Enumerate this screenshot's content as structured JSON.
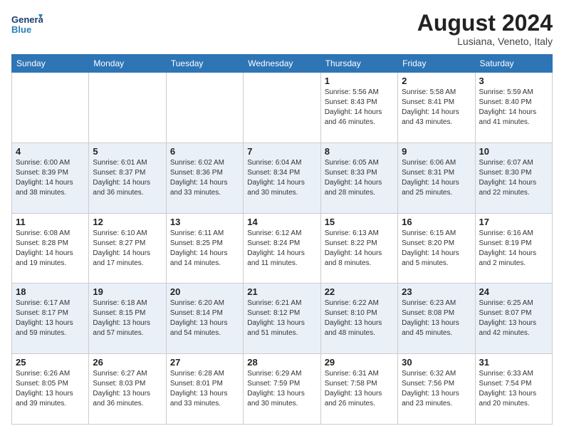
{
  "logo": {
    "line1": "General",
    "line2": "Blue"
  },
  "title": "August 2024",
  "location": "Lusiana, Veneto, Italy",
  "weekdays": [
    "Sunday",
    "Monday",
    "Tuesday",
    "Wednesday",
    "Thursday",
    "Friday",
    "Saturday"
  ],
  "weeks": [
    [
      {
        "day": "",
        "info": ""
      },
      {
        "day": "",
        "info": ""
      },
      {
        "day": "",
        "info": ""
      },
      {
        "day": "",
        "info": ""
      },
      {
        "day": "1",
        "info": "Sunrise: 5:56 AM\nSunset: 8:43 PM\nDaylight: 14 hours\nand 46 minutes."
      },
      {
        "day": "2",
        "info": "Sunrise: 5:58 AM\nSunset: 8:41 PM\nDaylight: 14 hours\nand 43 minutes."
      },
      {
        "day": "3",
        "info": "Sunrise: 5:59 AM\nSunset: 8:40 PM\nDaylight: 14 hours\nand 41 minutes."
      }
    ],
    [
      {
        "day": "4",
        "info": "Sunrise: 6:00 AM\nSunset: 8:39 PM\nDaylight: 14 hours\nand 38 minutes."
      },
      {
        "day": "5",
        "info": "Sunrise: 6:01 AM\nSunset: 8:37 PM\nDaylight: 14 hours\nand 36 minutes."
      },
      {
        "day": "6",
        "info": "Sunrise: 6:02 AM\nSunset: 8:36 PM\nDaylight: 14 hours\nand 33 minutes."
      },
      {
        "day": "7",
        "info": "Sunrise: 6:04 AM\nSunset: 8:34 PM\nDaylight: 14 hours\nand 30 minutes."
      },
      {
        "day": "8",
        "info": "Sunrise: 6:05 AM\nSunset: 8:33 PM\nDaylight: 14 hours\nand 28 minutes."
      },
      {
        "day": "9",
        "info": "Sunrise: 6:06 AM\nSunset: 8:31 PM\nDaylight: 14 hours\nand 25 minutes."
      },
      {
        "day": "10",
        "info": "Sunrise: 6:07 AM\nSunset: 8:30 PM\nDaylight: 14 hours\nand 22 minutes."
      }
    ],
    [
      {
        "day": "11",
        "info": "Sunrise: 6:08 AM\nSunset: 8:28 PM\nDaylight: 14 hours\nand 19 minutes."
      },
      {
        "day": "12",
        "info": "Sunrise: 6:10 AM\nSunset: 8:27 PM\nDaylight: 14 hours\nand 17 minutes."
      },
      {
        "day": "13",
        "info": "Sunrise: 6:11 AM\nSunset: 8:25 PM\nDaylight: 14 hours\nand 14 minutes."
      },
      {
        "day": "14",
        "info": "Sunrise: 6:12 AM\nSunset: 8:24 PM\nDaylight: 14 hours\nand 11 minutes."
      },
      {
        "day": "15",
        "info": "Sunrise: 6:13 AM\nSunset: 8:22 PM\nDaylight: 14 hours\nand 8 minutes."
      },
      {
        "day": "16",
        "info": "Sunrise: 6:15 AM\nSunset: 8:20 PM\nDaylight: 14 hours\nand 5 minutes."
      },
      {
        "day": "17",
        "info": "Sunrise: 6:16 AM\nSunset: 8:19 PM\nDaylight: 14 hours\nand 2 minutes."
      }
    ],
    [
      {
        "day": "18",
        "info": "Sunrise: 6:17 AM\nSunset: 8:17 PM\nDaylight: 13 hours\nand 59 minutes."
      },
      {
        "day": "19",
        "info": "Sunrise: 6:18 AM\nSunset: 8:15 PM\nDaylight: 13 hours\nand 57 minutes."
      },
      {
        "day": "20",
        "info": "Sunrise: 6:20 AM\nSunset: 8:14 PM\nDaylight: 13 hours\nand 54 minutes."
      },
      {
        "day": "21",
        "info": "Sunrise: 6:21 AM\nSunset: 8:12 PM\nDaylight: 13 hours\nand 51 minutes."
      },
      {
        "day": "22",
        "info": "Sunrise: 6:22 AM\nSunset: 8:10 PM\nDaylight: 13 hours\nand 48 minutes."
      },
      {
        "day": "23",
        "info": "Sunrise: 6:23 AM\nSunset: 8:08 PM\nDaylight: 13 hours\nand 45 minutes."
      },
      {
        "day": "24",
        "info": "Sunrise: 6:25 AM\nSunset: 8:07 PM\nDaylight: 13 hours\nand 42 minutes."
      }
    ],
    [
      {
        "day": "25",
        "info": "Sunrise: 6:26 AM\nSunset: 8:05 PM\nDaylight: 13 hours\nand 39 minutes."
      },
      {
        "day": "26",
        "info": "Sunrise: 6:27 AM\nSunset: 8:03 PM\nDaylight: 13 hours\nand 36 minutes."
      },
      {
        "day": "27",
        "info": "Sunrise: 6:28 AM\nSunset: 8:01 PM\nDaylight: 13 hours\nand 33 minutes."
      },
      {
        "day": "28",
        "info": "Sunrise: 6:29 AM\nSunset: 7:59 PM\nDaylight: 13 hours\nand 30 minutes."
      },
      {
        "day": "29",
        "info": "Sunrise: 6:31 AM\nSunset: 7:58 PM\nDaylight: 13 hours\nand 26 minutes."
      },
      {
        "day": "30",
        "info": "Sunrise: 6:32 AM\nSunset: 7:56 PM\nDaylight: 13 hours\nand 23 minutes."
      },
      {
        "day": "31",
        "info": "Sunrise: 6:33 AM\nSunset: 7:54 PM\nDaylight: 13 hours\nand 20 minutes."
      }
    ]
  ]
}
